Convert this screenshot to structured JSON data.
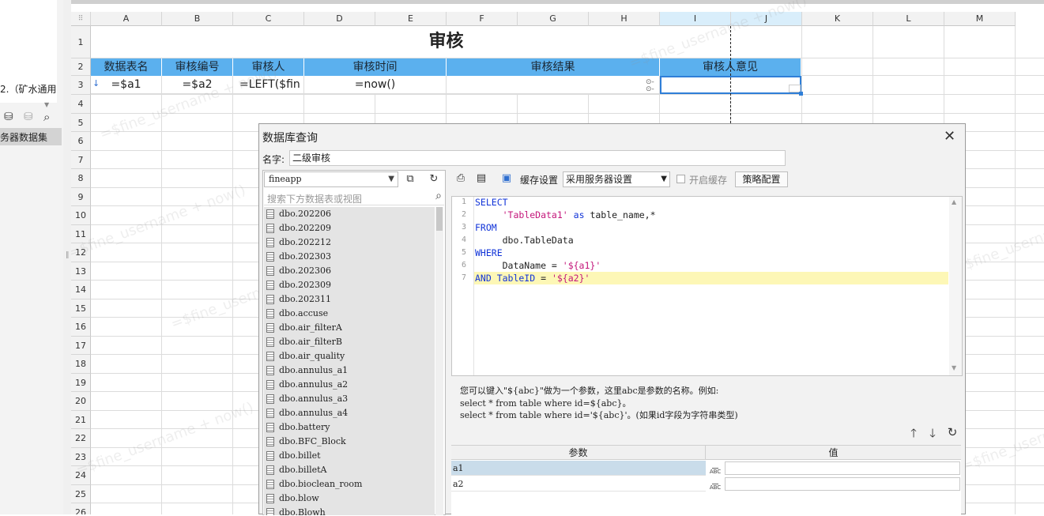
{
  "left_panel": {
    "partial_text": "2.（矿水通用",
    "dataset_label": "务器数据集",
    "icons": [
      "database-add-icon",
      "database-icon",
      "search-icon"
    ]
  },
  "sheet": {
    "columns": [
      "A",
      "B",
      "C",
      "D",
      "E",
      "F",
      "G",
      "H",
      "I",
      "J",
      "K",
      "L",
      "M"
    ],
    "rows": [
      "1",
      "2",
      "3",
      "4",
      "5",
      "6",
      "7",
      "8",
      "9",
      "10",
      "11",
      "12",
      "13",
      "14",
      "15",
      "16",
      "17",
      "18",
      "19",
      "20",
      "21",
      "22",
      "23",
      "24",
      "25",
      "26"
    ],
    "title": "审核",
    "headers": {
      "a": "数据表名",
      "b": "审核编号",
      "c": "审核人",
      "de": "审核时间",
      "fh": "审核结果",
      "ij": "审核人意见"
    },
    "row3": {
      "a": "=$a1",
      "b": "=$a2",
      "c": "=LEFT($fin",
      "de": "=now()"
    },
    "watermark": "=$fine_username + now()"
  },
  "dialog": {
    "title": "数据库查询",
    "name_label": "名字:",
    "name_value": "二级审核",
    "connection": "fineapp",
    "search_placeholder": "搜索下方数据表或视图",
    "tables": [
      "dbo.202206",
      "dbo.202209",
      "dbo.202212",
      "dbo.202303",
      "dbo.202306",
      "dbo.202309",
      "dbo.202311",
      "dbo.accuse",
      "dbo.air_filterA",
      "dbo.air_filterB",
      "dbo.air_quality",
      "dbo.annulus_a1",
      "dbo.annulus_a2",
      "dbo.annulus_a3",
      "dbo.annulus_a4",
      "dbo.battery",
      "dbo.BFC_Block",
      "dbo.billet",
      "dbo.billetA",
      "dbo.bioclean_room",
      "dbo.blow",
      "dbo.Blowh"
    ],
    "toolbar": {
      "cache_label": "缓存设置",
      "cache_option": "采用服务器设置",
      "enable_cache": "开启缓存",
      "strategy_button": "策略配置"
    },
    "sql_lines": [
      "1",
      "2",
      "3",
      "4",
      "5",
      "6",
      "7"
    ],
    "hint_lines": [
      "您可以键入\"${abc}\"做为一个参数，这里abc是参数的名称。例如:",
      "select * from table where id=${abc}。",
      "select * from table where id='${abc}'。(如果id字段为字符串类型)"
    ],
    "params_header": {
      "name": "参数",
      "value": "值"
    },
    "params": [
      {
        "name": "a1",
        "type": "ABC",
        "value": ""
      },
      {
        "name": "a2",
        "type": "ABC",
        "value": ""
      }
    ],
    "colors": {
      "header_blue": "#5bb0ee",
      "selection": "#2f7fd8",
      "keyword": "#1234d8",
      "string": "#c4177b"
    }
  }
}
